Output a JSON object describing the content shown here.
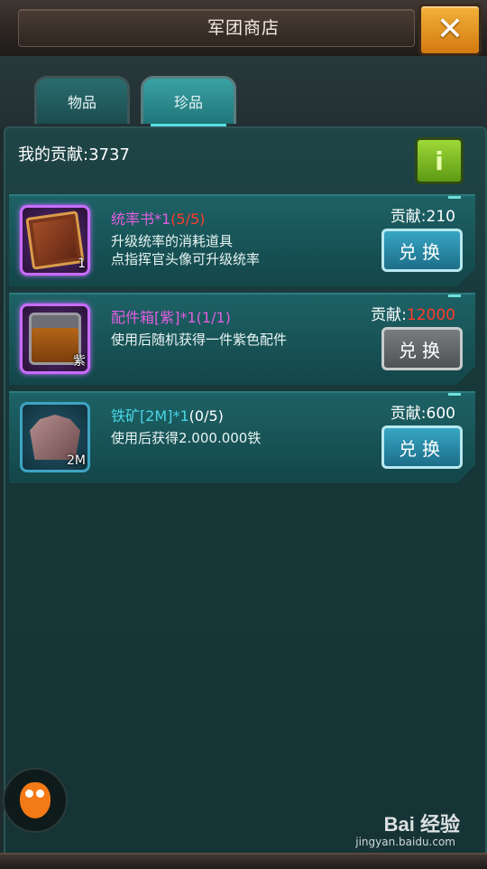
{
  "header": {
    "title": "军团商店",
    "close_symbol": "✕"
  },
  "tabs": [
    {
      "label": "物品",
      "active": false
    },
    {
      "label": "珍品",
      "active": true
    }
  ],
  "contribution": {
    "label": "我的贡献:3737"
  },
  "info_button": {
    "label": "i"
  },
  "items": [
    {
      "name": "统率书*1",
      "limit": "(5/5)",
      "desc": "升级统率的消耗道具\n点指挥官头像可升级统率",
      "cost_label": "贡献:",
      "cost_value": "210",
      "button": "兑换",
      "badge": "1",
      "rarity": "purple"
    },
    {
      "name": "配件箱[紫]*1",
      "limit": "(1/1)",
      "desc": "使用后随机获得一件紫色配件",
      "cost_label": "贡献:",
      "cost_value": "12000",
      "button": "兑换",
      "badge": "紫",
      "rarity": "purple"
    },
    {
      "name": "铁矿[2M]*1",
      "limit": "(0/5)",
      "desc": "使用后获得2.000.000铁",
      "cost_label": "贡献:",
      "cost_value": "600",
      "button": "兑换",
      "badge": "2M",
      "rarity": "blue"
    }
  ],
  "watermark": {
    "main": "Bai 经验",
    "sub": "jingyan.baidu.com"
  },
  "colors": {
    "accent": "#37a6c4",
    "purple_name": "#e05fe0",
    "red_cost": "#ff3a2a",
    "blue_name": "#49d6e4"
  }
}
